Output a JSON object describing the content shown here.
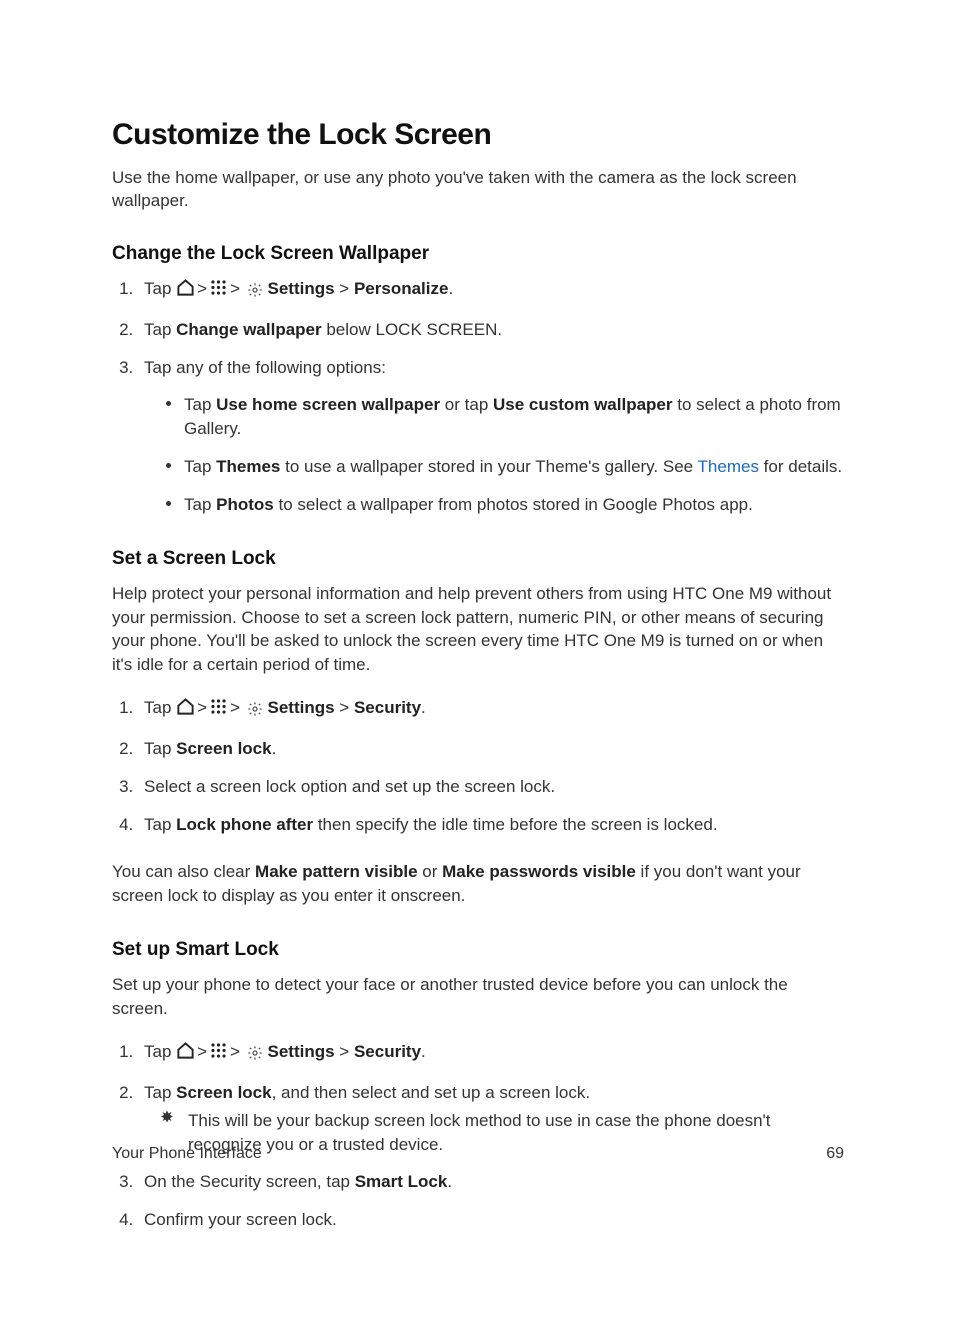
{
  "title": "Customize the Lock Screen",
  "intro": "Use the home wallpaper, or use any photo you've taken with the camera as the lock screen wallpaper.",
  "s1": {
    "heading": "Change the Lock Screen Wallpaper",
    "step1_pre": "Tap ",
    "settings": "Settings",
    "personalize": "Personalize",
    "step2_pre": "Tap ",
    "step2_bold": "Change wallpaper",
    "step2_post": " below LOCK SCREEN.",
    "step3": "Tap any of the following options:",
    "b1_pre": "Tap ",
    "b1_a": "Use home screen wallpaper",
    "b1_mid": " or tap ",
    "b1_b": "Use custom wallpaper",
    "b1_post": " to select a photo from Gallery.",
    "b2_pre": "Tap ",
    "b2_bold": "Themes",
    "b2_mid": " to use a wallpaper stored in your Theme's gallery. See ",
    "b2_link": "Themes",
    "b2_post": " for details.",
    "b3_pre": "Tap ",
    "b3_bold": "Photos",
    "b3_post": " to select a wallpaper from photos stored in Google Photos app."
  },
  "s2": {
    "heading": "Set a Screen Lock",
    "intro": "Help protect your personal information and help prevent others from using HTC One M9 without your permission. Choose to set a screen lock pattern, numeric PIN, or other means of securing your phone. You'll be asked to unlock the screen every time HTC One M9 is turned on or when it's idle for a certain period of time.",
    "step1_pre": "Tap ",
    "settings": "Settings",
    "security": "Security",
    "step2_pre": "Tap ",
    "step2_bold": "Screen lock",
    "step2_post": ".",
    "step3": "Select a screen lock option and set up the screen lock.",
    "step4_pre": "Tap ",
    "step4_bold": "Lock phone after",
    "step4_post": " then specify the idle time before the screen is locked.",
    "after_pre": "You can also clear ",
    "after_a": "Make pattern visible",
    "after_mid": " or ",
    "after_b": "Make passwords visible",
    "after_post": " if you don't want your screen lock to display as you enter it onscreen."
  },
  "s3": {
    "heading": "Set up Smart Lock",
    "intro": "Set up your phone to detect your face or another trusted device before you can unlock the screen.",
    "step1_pre": "Tap ",
    "settings": "Settings",
    "security": "Security",
    "step2_pre": "Tap ",
    "step2_bold": "Screen lock",
    "step2_post": ", and then select and set up a screen lock.",
    "note": "This will be your backup screen lock method to use in case the phone doesn't recognize you or a trusted device.",
    "step3_pre": "On the Security screen, tap ",
    "step3_bold": "Smart Lock",
    "step3_post": ".",
    "step4": "Confirm your screen lock."
  },
  "gt": ">",
  "period": ".",
  "footer": {
    "left": "Your Phone Interface",
    "right": "69"
  }
}
